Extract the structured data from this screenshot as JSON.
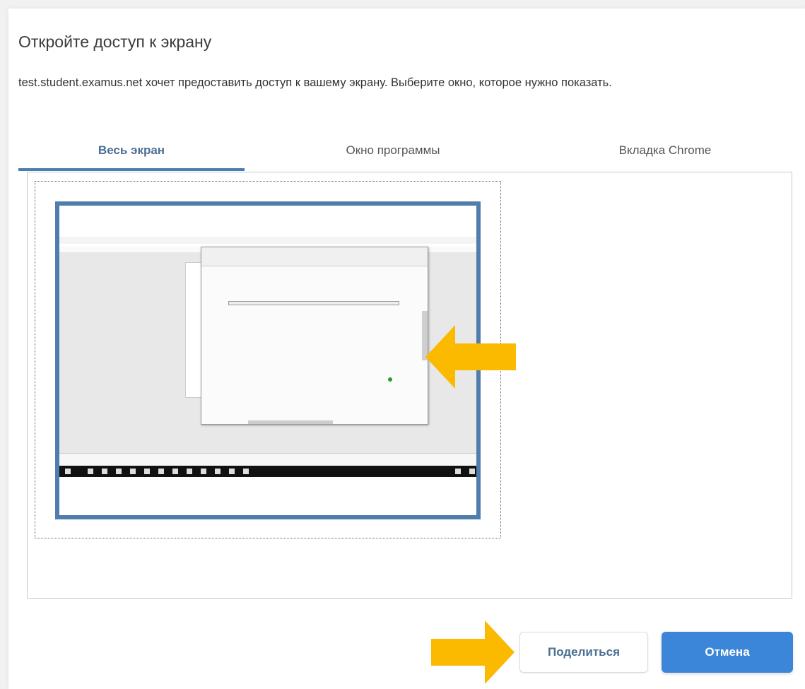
{
  "dialog": {
    "title": "Откройте доступ к экрану",
    "description": "test.student.examus.net хочет предоставить доступ к вашему экрану. Выберите окно, которое нужно показать."
  },
  "tabs": [
    {
      "label": "Весь экран",
      "active": true
    },
    {
      "label": "Окно программы",
      "active": false
    },
    {
      "label": "Вкладка Chrome",
      "active": false
    }
  ],
  "buttons": {
    "share_label": "Поделиться",
    "cancel_label": "Отмена"
  },
  "colors": {
    "accent": "#3b86d9",
    "tab_active": "#4a7eb0",
    "thumbnail_border": "#4f7eac",
    "annotation_arrow": "#fbb900"
  },
  "icons": {
    "annotation": "arrow-icon"
  }
}
